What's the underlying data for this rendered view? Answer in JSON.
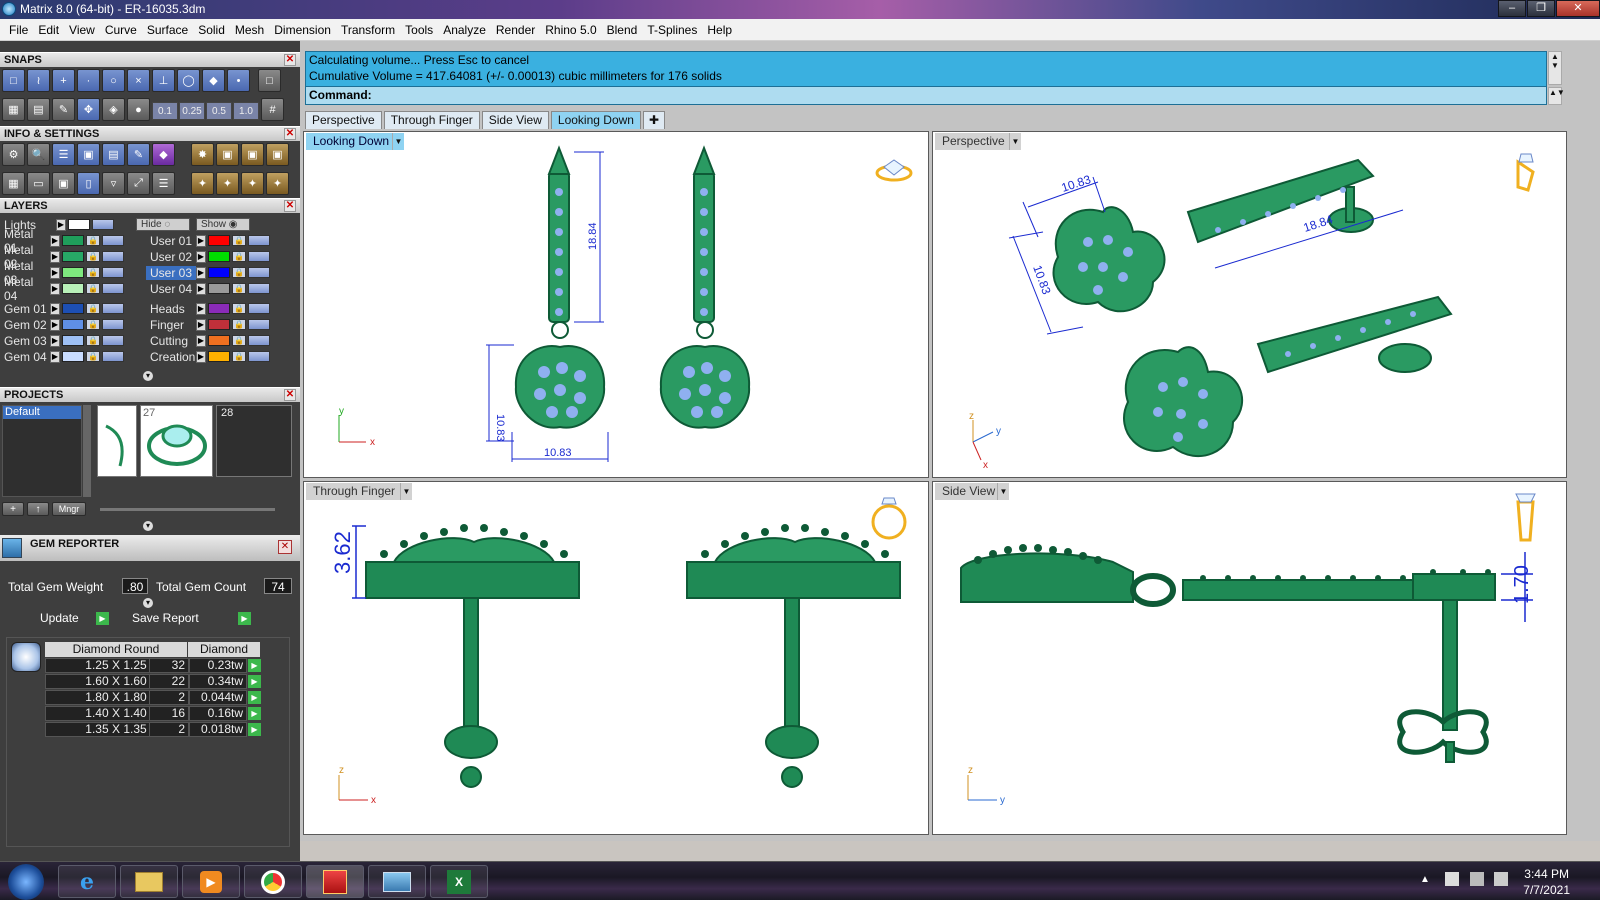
{
  "window": {
    "title": "Matrix 8.0 (64-bit) - ER-16035.3dm"
  },
  "menu": [
    "File",
    "Edit",
    "View",
    "Curve",
    "Surface",
    "Solid",
    "Mesh",
    "Dimension",
    "Transform",
    "Tools",
    "Analyze",
    "Render",
    "Rhino 5.0",
    "Blend",
    "T-Splines",
    "Help"
  ],
  "panels": {
    "snaps_title": "SNAPS",
    "grid_values": [
      "0.1",
      "0.25",
      "0.5",
      "1.0"
    ],
    "info_title": "INFO & SETTINGS",
    "layers_title": "LAYERS",
    "projects_title": "PROJECTS",
    "gem_reporter_title": "GEM REPORTER"
  },
  "layers": {
    "lights_label": "Lights",
    "hide_label": "Hide",
    "show_label": "Show",
    "left": [
      {
        "name": "Metal 01",
        "color": "#1f9e5b"
      },
      {
        "name": "Metal 02",
        "color": "#27a866"
      },
      {
        "name": "Metal 03",
        "color": "#7ee87e"
      },
      {
        "name": "Metal 04",
        "color": "#b8f0b8"
      },
      {
        "name": "Gem 01",
        "color": "#1d4fb3"
      },
      {
        "name": "Gem 02",
        "color": "#5f8fe6"
      },
      {
        "name": "Gem 03",
        "color": "#9ec0f5"
      },
      {
        "name": "Gem 04",
        "color": "#c9dcff"
      }
    ],
    "right": [
      {
        "name": "User 01",
        "color": "#ff0000"
      },
      {
        "name": "User 02",
        "color": "#00dd00"
      },
      {
        "name": "User 03",
        "color": "#0000ff"
      },
      {
        "name": "User 04",
        "color": "#9a9a9a"
      },
      {
        "name": "Heads",
        "color": "#8a2bb8"
      },
      {
        "name": "Finger",
        "color": "#c0303a"
      },
      {
        "name": "Cutting",
        "color": "#f07020"
      },
      {
        "name": "Creation",
        "color": "#ffb000"
      }
    ]
  },
  "projects": {
    "default_label": "Default",
    "thumb_numbers": [
      "27",
      "28"
    ],
    "mngr_label": "Mngr"
  },
  "gem_reporter": {
    "total_weight_label": "Total Gem Weight",
    "total_weight": ".80",
    "total_count_label": "Total Gem Count",
    "total_count": "74",
    "update_label": "Update",
    "save_label": "Save Report",
    "col_shape": "Diamond Round",
    "col_type": "Diamond",
    "rows": [
      {
        "size": "1.25 X 1.25",
        "count": "32",
        "weight": "0.23tw"
      },
      {
        "size": "1.60 X 1.60",
        "count": "22",
        "weight": "0.34tw"
      },
      {
        "size": "1.80 X 1.80",
        "count": "2",
        "weight": "0.044tw"
      },
      {
        "size": "1.40 X 1.40",
        "count": "16",
        "weight": "0.16tw"
      },
      {
        "size": "1.35 X 1.35",
        "count": "2",
        "weight": "0.018tw"
      }
    ]
  },
  "command": {
    "line1": "Calculating volume... Press Esc to cancel",
    "line2": "Cumulative Volume = 417.64081 (+/- 0.00013) cubic millimeters for 176 solids",
    "prompt": "Command:"
  },
  "tabs": [
    "Perspective",
    "Through Finger",
    "Side View",
    "Looking Down"
  ],
  "viewports": {
    "top_left": {
      "label": "Looking Down",
      "dim_h": "18.84",
      "dim_v": "10.83",
      "dim_w": "10.83"
    },
    "top_right": {
      "label": "Perspective",
      "dim_a": "10.83",
      "dim_b": "10.83",
      "dim_c": "18.84"
    },
    "bottom_left": {
      "label": "Through Finger",
      "dim": "3.62"
    },
    "bottom_right": {
      "label": "Side View",
      "dim": "1.70"
    }
  },
  "axes": {
    "x": "x",
    "y": "y",
    "z": "z"
  },
  "clock": {
    "time": "3:44 PM",
    "date": "7/7/2021"
  },
  "colors": {
    "metal": "#1f8a55",
    "gem": "#8fb0f0",
    "dim": "#1a2ad0",
    "accent": "#3ab0e0"
  }
}
